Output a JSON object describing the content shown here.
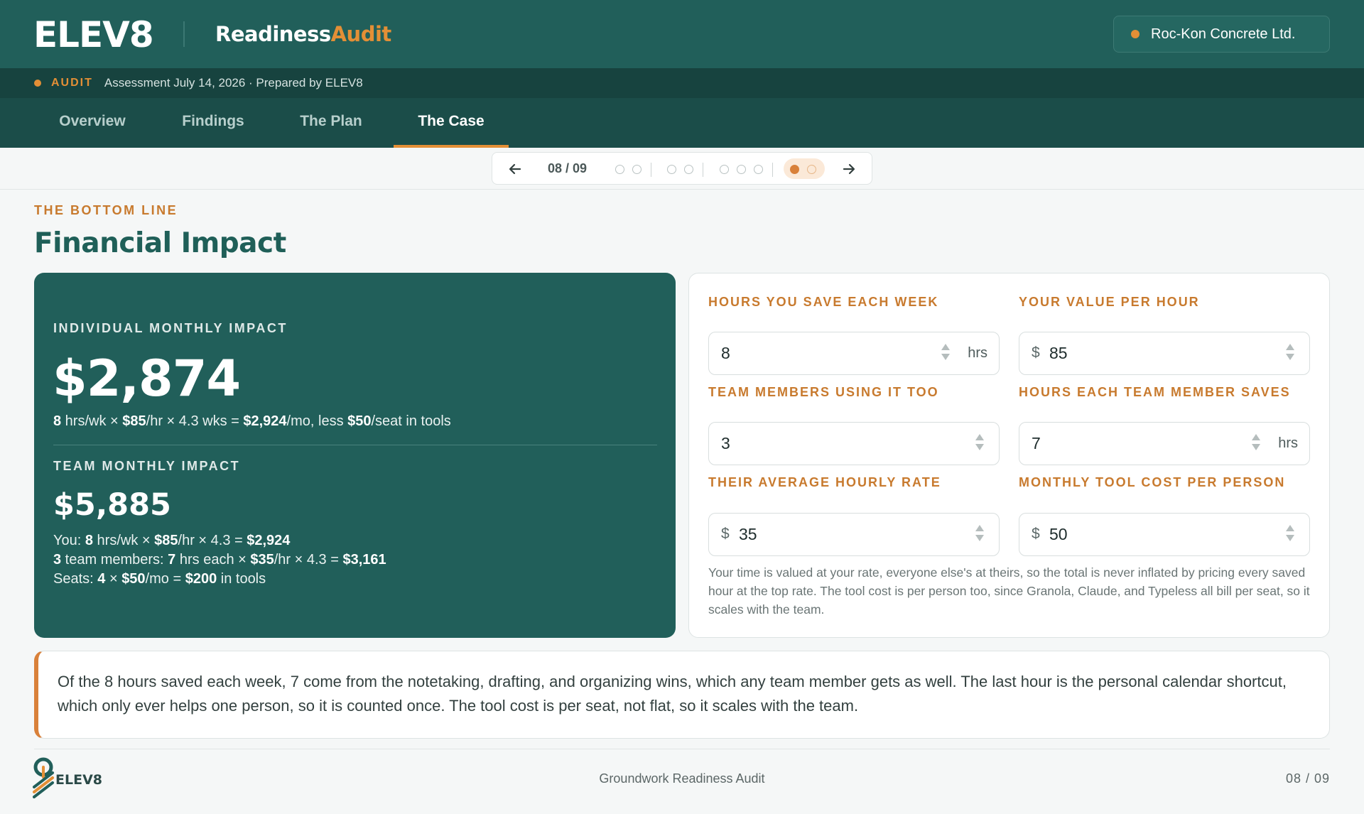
{
  "header": {
    "logo": "ELEV8",
    "product_main": "Readiness",
    "product_accent": "Audit",
    "client_name": "Roc-Kon Concrete Ltd."
  },
  "subbar": {
    "tag": "AUDIT",
    "meta": "Assessment July 14, 2026 · Prepared by ELEV8"
  },
  "tabs": [
    {
      "label": "Overview",
      "active": false
    },
    {
      "label": "Findings",
      "active": false
    },
    {
      "label": "The Plan",
      "active": false
    },
    {
      "label": "The Case",
      "active": true
    }
  ],
  "pager": {
    "count": "08 / 09",
    "current": 8,
    "total": 9,
    "groups": [
      2,
      2,
      3,
      2
    ]
  },
  "section": {
    "eyebrow": "THE BOTTOM LINE",
    "title": "Financial Impact"
  },
  "impact": {
    "individual_label": "INDIVIDUAL MONTHLY IMPACT",
    "individual_value": "$2,874",
    "individual_formula": {
      "hrs": "8",
      "t1": " hrs/wk × ",
      "rate": "$85",
      "t2": "/hr × 4.3 wks = ",
      "gross": "$2,924",
      "t3": "/mo, less ",
      "seat": "$50",
      "t4": "/seat in tools"
    },
    "team_label": "TEAM MONTHLY IMPACT",
    "team_value": "$5,885",
    "team_lines": {
      "you": {
        "p0": "You: ",
        "hrs": "8",
        "t1": " hrs/wk × ",
        "rate": "$85",
        "t2": "/hr × 4.3 = ",
        "total": "$2,924"
      },
      "members": {
        "count": "3",
        "t1": " team members: ",
        "hrs": "7",
        "t2": " hrs each × ",
        "rate": "$35",
        "t3": "/hr × 4.3 = ",
        "total": "$3,161"
      },
      "seats": {
        "p0": "Seats: ",
        "count": "4",
        "t1": " × ",
        "cost": "$50",
        "t2": "/mo = ",
        "total": "$200",
        "t3": " in tools"
      }
    }
  },
  "form": {
    "fields": [
      {
        "label": "HOURS YOU SAVE EACH WEEK",
        "prefix": "",
        "value": "8",
        "unit": "hrs"
      },
      {
        "label": "YOUR VALUE PER HOUR",
        "prefix": "$",
        "value": "85",
        "unit": ""
      },
      {
        "label": "TEAM MEMBERS USING IT TOO",
        "prefix": "",
        "value": "3",
        "unit": ""
      },
      {
        "label": "HOURS EACH TEAM MEMBER SAVES",
        "prefix": "",
        "value": "7",
        "unit": "hrs"
      },
      {
        "label": "THEIR AVERAGE HOURLY RATE",
        "prefix": "$",
        "value": "35",
        "unit": ""
      },
      {
        "label": "MONTHLY TOOL COST PER PERSON",
        "prefix": "$",
        "value": "50",
        "unit": ""
      }
    ],
    "note": "Your time is valued at your rate, everyone else's at theirs, so the total is never inflated by pricing every saved hour at the top rate. The tool cost is per person too, since Granola, Claude, and Typeless all bill per seat, so it scales with the team."
  },
  "callout": "Of the 8 hours saved each week, 7 come from the notetaking, drafting, and organizing wins, which any team member gets as well. The last hour is the personal calendar shortcut, which only ever helps one person, so it is counted once. The tool cost is per seat, not flat, so it scales with the team.",
  "footer": {
    "logo_text": "ELEV8",
    "center": "Groundwork Readiness Audit",
    "page": "08 / 09"
  },
  "colors": {
    "brand_teal": "#215f5a",
    "accent_orange": "#e38f36"
  }
}
